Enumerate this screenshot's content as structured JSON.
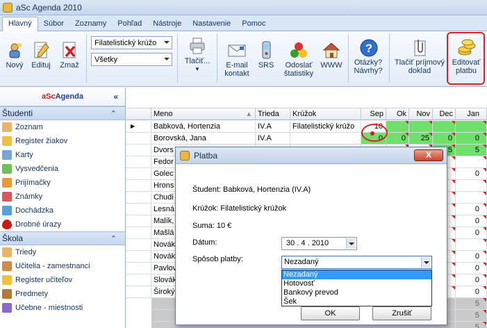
{
  "window": {
    "title": "aSc Agenda 2010"
  },
  "menu": [
    "Hlavný",
    "Súbor",
    "Zoznamy",
    "Pohľad",
    "Nástroje",
    "Nastavenie",
    "Pomoc"
  ],
  "ribbon": {
    "new": "Nový",
    "edit": "Edituj",
    "delete": "Zmaž",
    "club_combo": "Filatelistický krúžo",
    "filter_combo": "Všetky",
    "print": "Tlačiť...",
    "email": "E-mail",
    "email2": "kontakt",
    "srs": "SRS",
    "stats": "Odoslať",
    "stats2": "štatistiky",
    "www": "WWW",
    "help": "Otázky?",
    "help2": "Návrhy?",
    "receipt": "Tlačiť príjmový",
    "receipt2": "doklad",
    "payment": "Editovať",
    "payment2": "platbu"
  },
  "sidebar": {
    "brand_a": "aSc",
    "brand_b": "Agenda",
    "students_header": "Študenti",
    "students_items": [
      "Zoznam",
      "Register žiakov",
      "Karty",
      "Vysvedčenia",
      "Prijímačky",
      "Známky",
      "Dochádzka",
      "Drobné úrazy"
    ],
    "school_header": "Škola",
    "school_items": [
      "Triedy",
      "Učitelia - zamestnanci",
      "Register učiteľov",
      "Predmety",
      "Učebne - miestnosti"
    ]
  },
  "grid": {
    "headers": [
      "Meno",
      "Trieda",
      "Krúžok",
      "Sep",
      "Ok",
      "Nov",
      "Dec",
      "Jan"
    ],
    "rows": [
      {
        "name": "Babková, Hortenzia",
        "class": "IV.A",
        "club": "Filatelistický krúžo",
        "sep": "10",
        "ok": "",
        "nov": "",
        "dec": "",
        "jan": ""
      },
      {
        "name": "Borovská, Jana",
        "class": "IV.A",
        "club": "",
        "sep": "0",
        "ok": "0",
        "nov": "25",
        "dec": "0",
        "jan": "0"
      },
      {
        "name": "Dvors",
        "class": "",
        "club": "",
        "sep": "",
        "ok": "",
        "nov": "",
        "dec": "5",
        "jan": "5"
      },
      {
        "name": "Fedor",
        "class": "",
        "club": "",
        "sep": "",
        "ok": "",
        "nov": "",
        "dec": "",
        "jan": ""
      },
      {
        "name": "Golec",
        "class": "",
        "club": "",
        "sep": "",
        "ok": "",
        "nov": "",
        "dec": "",
        "jan": "0"
      },
      {
        "name": "Hrons",
        "class": "",
        "club": "",
        "sep": "",
        "ok": "",
        "nov": "",
        "dec": "",
        "jan": ""
      },
      {
        "name": "Chudi",
        "class": "",
        "club": "",
        "sep": "",
        "ok": "",
        "nov": "",
        "dec": "",
        "jan": ""
      },
      {
        "name": "Lesná",
        "class": "",
        "club": "",
        "sep": "",
        "ok": "",
        "nov": "",
        "dec": "",
        "jan": "0"
      },
      {
        "name": "Malík,",
        "class": "",
        "club": "",
        "sep": "",
        "ok": "",
        "nov": "",
        "dec": "",
        "jan": "0"
      },
      {
        "name": "Mašlá",
        "class": "",
        "club": "",
        "sep": "",
        "ok": "",
        "nov": "",
        "dec": "",
        "jan": "0"
      },
      {
        "name": "Novák",
        "class": "",
        "club": "",
        "sep": "",
        "ok": "",
        "nov": "",
        "dec": "",
        "jan": ""
      },
      {
        "name": "Novák",
        "class": "",
        "club": "",
        "sep": "",
        "ok": "",
        "nov": "",
        "dec": "",
        "jan": "0"
      },
      {
        "name": "Pavlov",
        "class": "",
        "club": "",
        "sep": "",
        "ok": "",
        "nov": "",
        "dec": "",
        "jan": "0"
      },
      {
        "name": "Slovák",
        "class": "",
        "club": "",
        "sep": "",
        "ok": "",
        "nov": "",
        "dec": "",
        "jan": "0"
      },
      {
        "name": "Široký",
        "class": "",
        "club": "",
        "sep": "",
        "ok": "",
        "nov": "",
        "dec": "",
        "jan": "0"
      }
    ],
    "tail_values": [
      "5",
      "5",
      "5"
    ]
  },
  "dialog": {
    "title": "Platba",
    "close": "X",
    "student": "Študent: Babková, Hortenzia (IV.A)",
    "club": "Krúžok: Filatelistický krúžok",
    "sum": "Suma: 10 €",
    "date_label": "Dátum:",
    "date_value": "30 .  4 . 2010",
    "method_label": "Spôsob platby:",
    "method_value": "Nezadaný",
    "options": [
      "Nezadaný",
      "Hotovosť",
      "Bankový prevod",
      "Šek"
    ],
    "ok": "OK",
    "cancel": "Zrušiť"
  }
}
